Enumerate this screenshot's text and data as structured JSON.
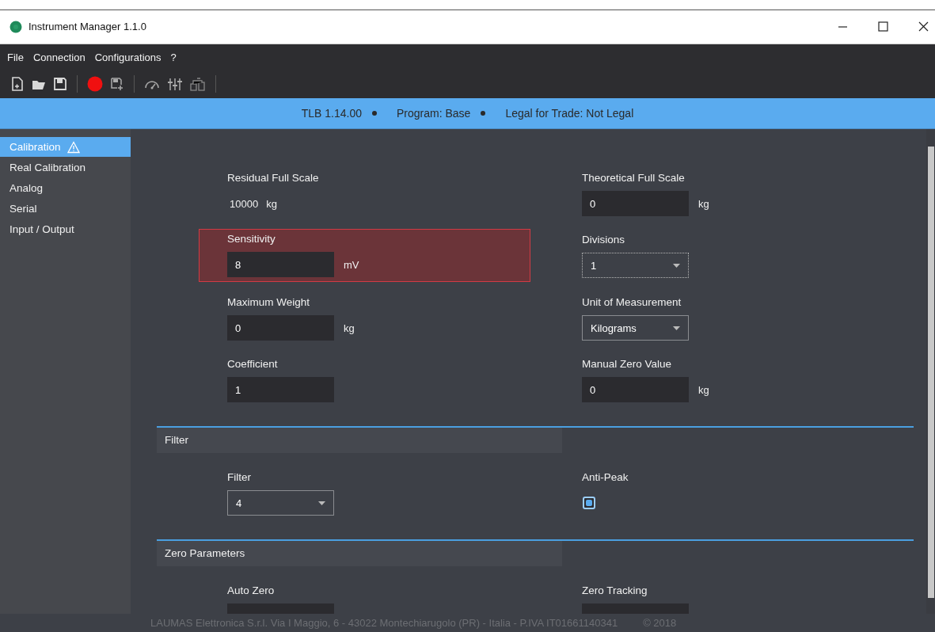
{
  "window": {
    "title": "Instrument Manager 1.1.0"
  },
  "menu": [
    "File",
    "Connection",
    "Configurations",
    "?"
  ],
  "status_bar": [
    "TLB 1.14.00",
    "Program: Base",
    "Legal for Trade: Not Legal"
  ],
  "sidebar": {
    "items": [
      {
        "label": "Calibration",
        "selected": true,
        "warning": true
      },
      {
        "label": "Real Calibration",
        "selected": false,
        "warning": false
      },
      {
        "label": "Analog",
        "selected": false,
        "warning": false
      },
      {
        "label": "Serial",
        "selected": false,
        "warning": false
      },
      {
        "label": "Input / Output",
        "selected": false,
        "warning": false
      }
    ]
  },
  "sections": [
    {
      "fields": [
        {
          "kind": "readout",
          "label": "Residual Full Scale",
          "value": "10000",
          "unit": "kg",
          "error": false
        },
        {
          "kind": "input",
          "label": "Theoretical Full Scale",
          "value": "0",
          "unit": "kg",
          "error": false
        },
        {
          "kind": "input",
          "label": "Sensitivity",
          "value": "8",
          "unit": "mV",
          "error": true
        },
        {
          "kind": "dropdown",
          "label": "Divisions",
          "value": "1",
          "focused": true,
          "error": false
        },
        {
          "kind": "input",
          "label": "Maximum Weight",
          "value": "0",
          "unit": "kg",
          "error": false
        },
        {
          "kind": "dropdown",
          "label": "Unit of Measurement",
          "value": "Kilograms",
          "focused": false,
          "error": false
        },
        {
          "kind": "input",
          "label": "Coefficient",
          "value": "1",
          "error": false
        },
        {
          "kind": "input",
          "label": "Manual Zero Value",
          "value": "0",
          "unit": "kg",
          "error": false
        }
      ]
    },
    {
      "title": "Filter",
      "fields": [
        {
          "kind": "dropdown",
          "label": "Filter",
          "value": "4",
          "focused": false,
          "error": false
        },
        {
          "kind": "checkbox",
          "label": "Anti-Peak",
          "checked": true,
          "error": false
        }
      ]
    },
    {
      "title": "Zero Parameters",
      "fields": [
        {
          "kind": "input",
          "label": "Auto Zero",
          "error": false
        },
        {
          "kind": "input",
          "label": "Zero Tracking",
          "error": false
        }
      ]
    }
  ],
  "footer": {
    "address": "LAUMAS Elettronica S.r.l. Via I Maggio, 6 - 43022 Montechiarugolo (PR) - Italia - P.IVA IT01661140341",
    "copyright": "© 2018"
  }
}
